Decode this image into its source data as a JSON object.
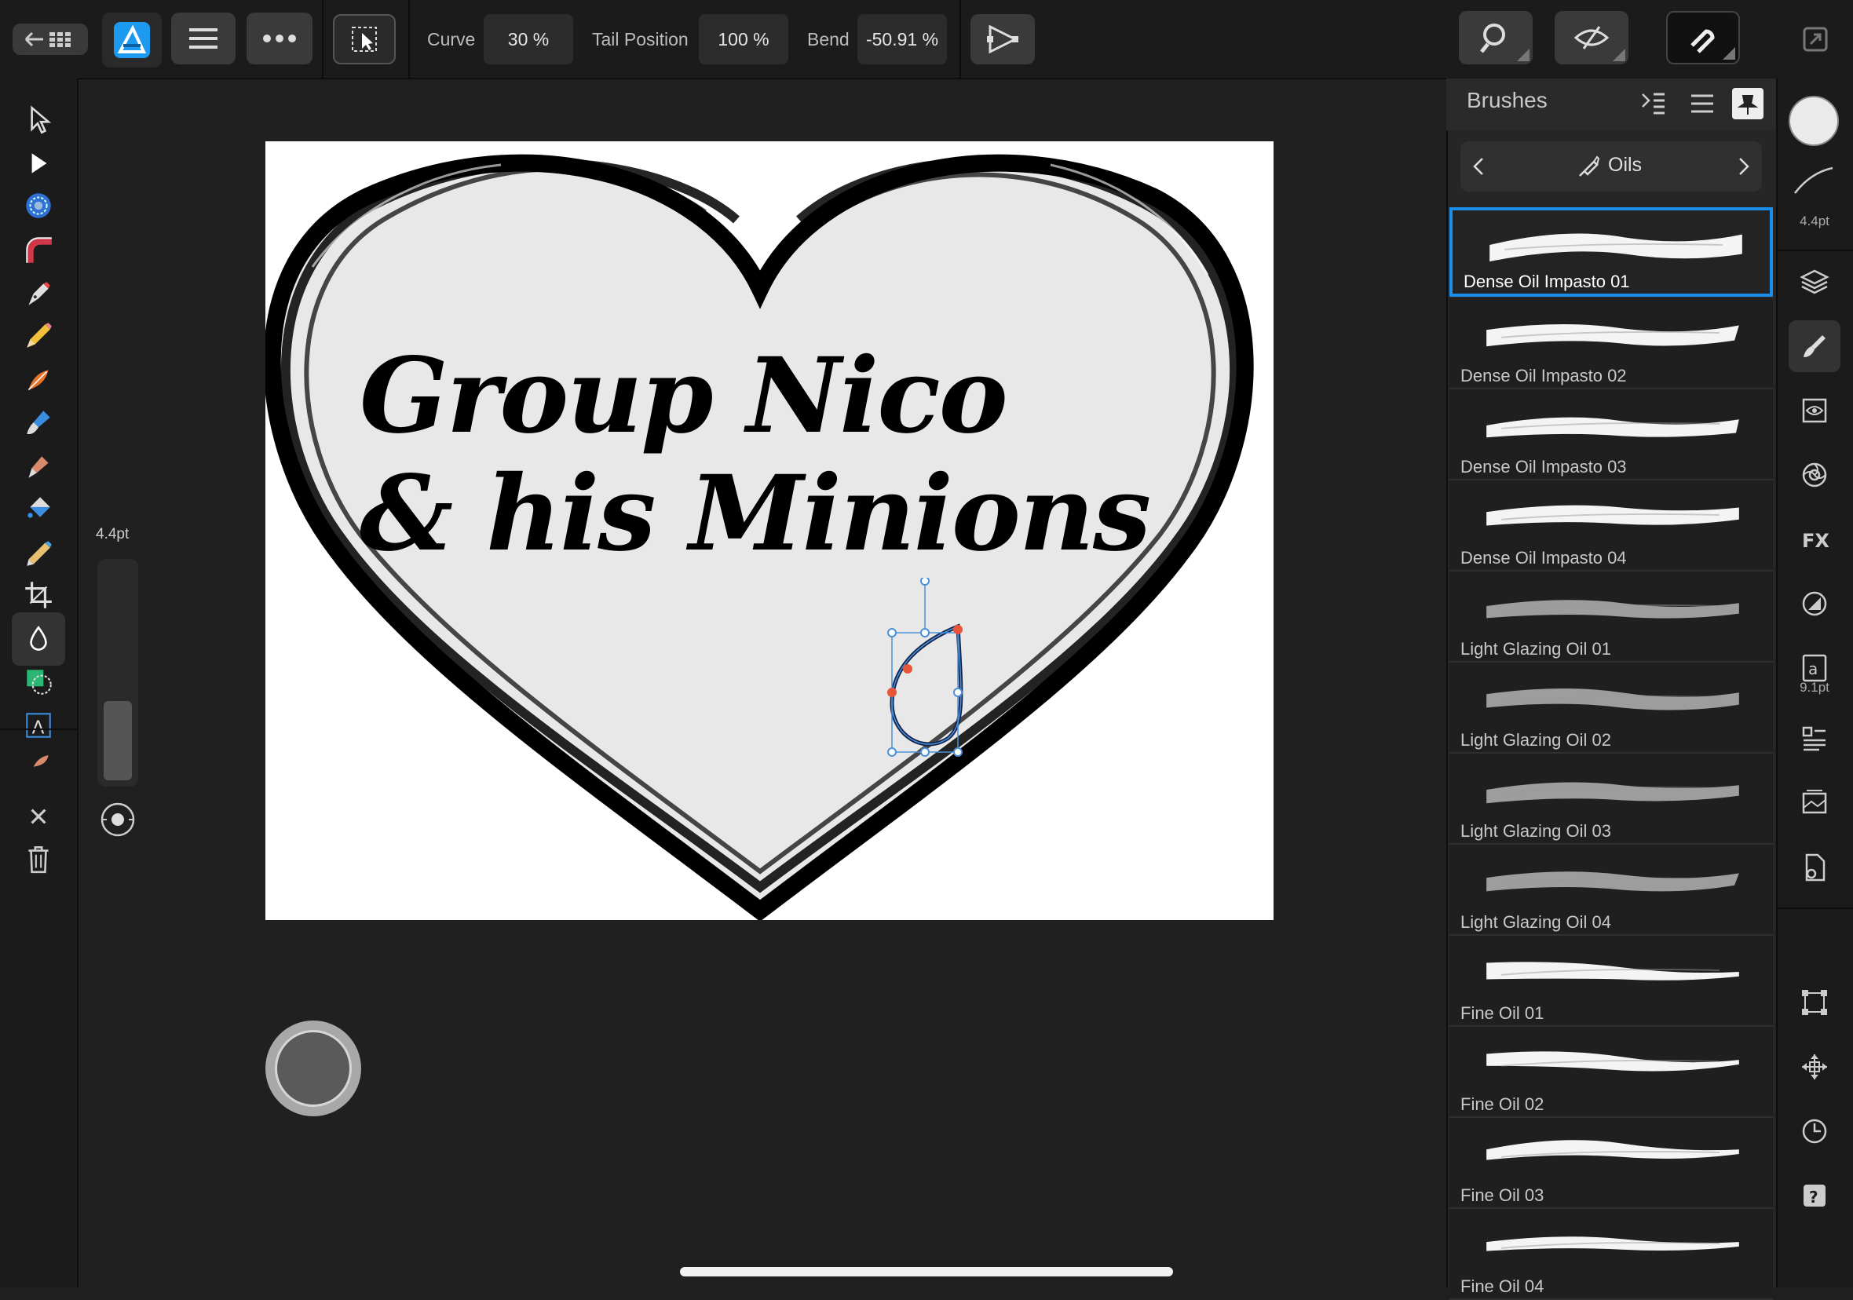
{
  "toolbar": {
    "curve_label": "Curve",
    "curve_value": "30 %",
    "tail_label": "Tail Position",
    "tail_value": "100 %",
    "bend_label": "Bend",
    "bend_value": "-50.91 %"
  },
  "canvas": {
    "text_line1": "Group Nico",
    "text_line2": "& his Minions"
  },
  "size_slider": {
    "label": "4.4pt",
    "level": 0.37
  },
  "panel": {
    "title": "Brushes",
    "category": "Oils",
    "brushes": [
      {
        "name": "Dense Oil Impasto 01"
      },
      {
        "name": "Dense Oil Impasto 02"
      },
      {
        "name": "Dense Oil Impasto 03"
      },
      {
        "name": "Dense Oil Impasto 04"
      },
      {
        "name": "Light Glazing Oil 01"
      },
      {
        "name": "Light Glazing Oil 02"
      },
      {
        "name": "Light Glazing Oil 03"
      },
      {
        "name": "Light Glazing Oil 04"
      },
      {
        "name": "Fine Oil 01"
      },
      {
        "name": "Fine Oil 02"
      },
      {
        "name": "Fine Oil 03"
      },
      {
        "name": "Fine Oil 04"
      }
    ]
  },
  "studio": {
    "stroke_width": "4.4pt",
    "text_size": "9.1pt"
  },
  "colors": {
    "accent": "#1a8ee8",
    "background": "#202020",
    "panel": "#262626",
    "heart_fill": "#e8e8e8",
    "handle_orange": "#e8553a"
  }
}
